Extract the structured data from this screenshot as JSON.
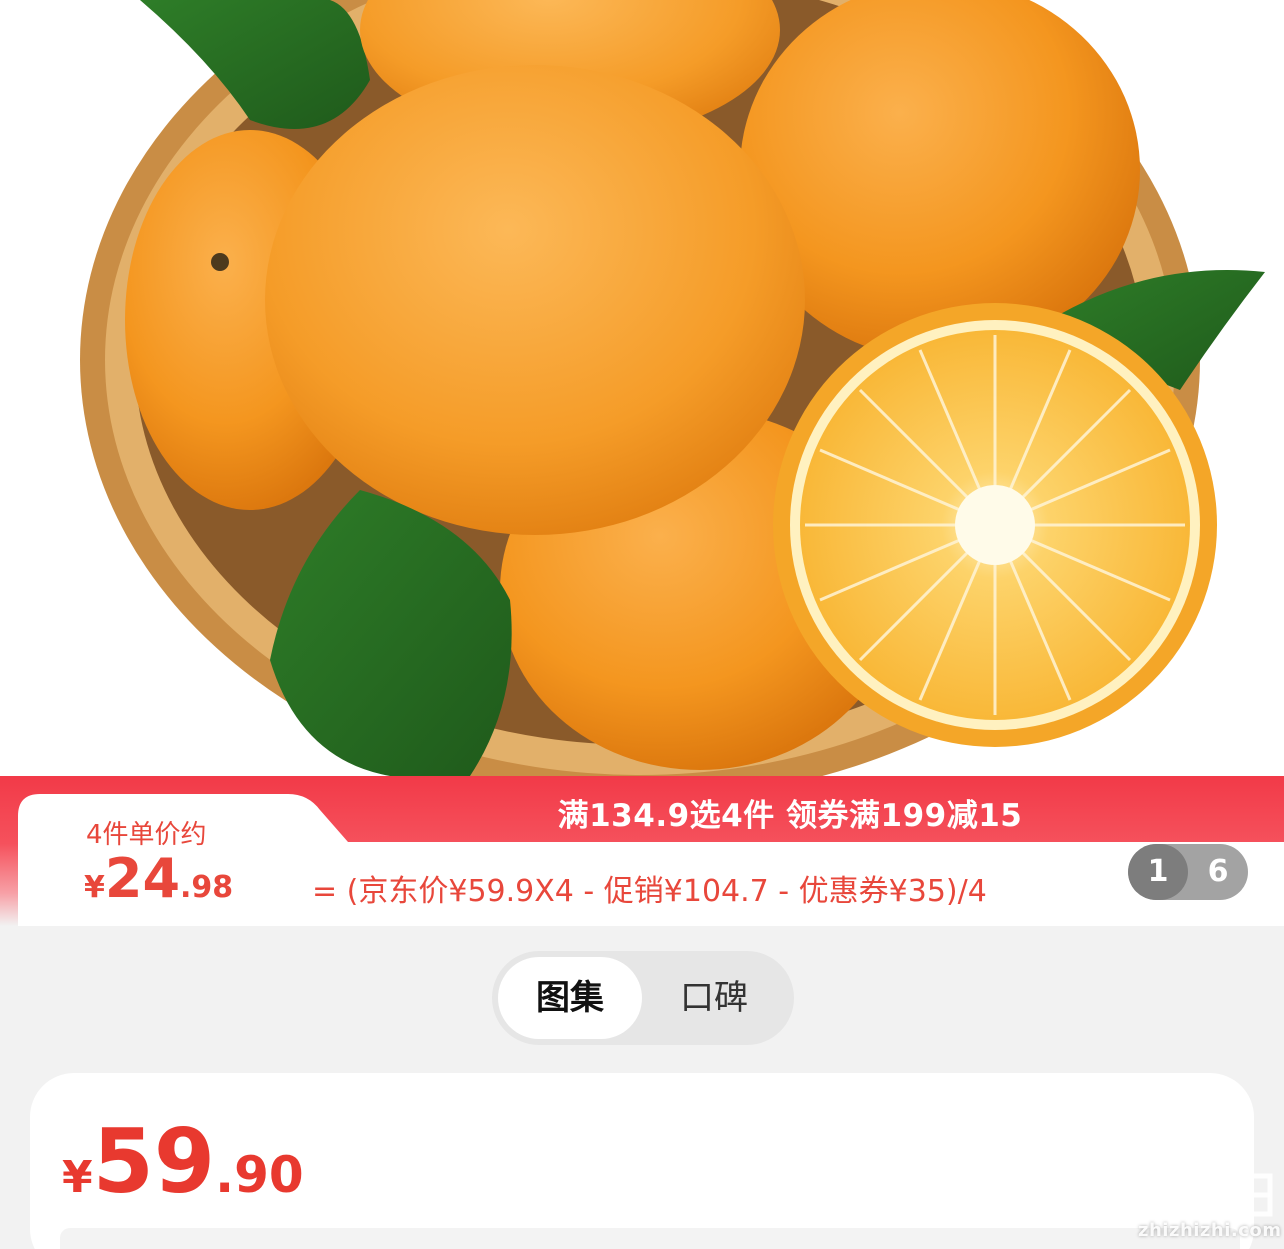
{
  "product_image": {
    "icon": "orange-basket-image"
  },
  "promo": {
    "headline": "满134.9选4件 领券满199减15",
    "unit_label": "4件单价约",
    "unit_price": {
      "currency": "¥",
      "integer": "24",
      "decimal": ".98"
    },
    "formula": "= (京东价¥59.9X4 - 促销¥104.7 - 优惠券¥35)/4",
    "colors": {
      "banner": "#f23a48",
      "price_text": "#e8473b"
    }
  },
  "pager": {
    "current": "1",
    "total": "6"
  },
  "tabs": [
    {
      "label": "图集",
      "active": true
    },
    {
      "label": "口碑",
      "active": false
    }
  ],
  "price": {
    "currency": "¥",
    "integer": "59",
    "decimal": ".90",
    "color": "#e8392f"
  },
  "watermark": {
    "text": "zhizhizhi.com",
    "icon": "zhizhizhi-logo"
  }
}
